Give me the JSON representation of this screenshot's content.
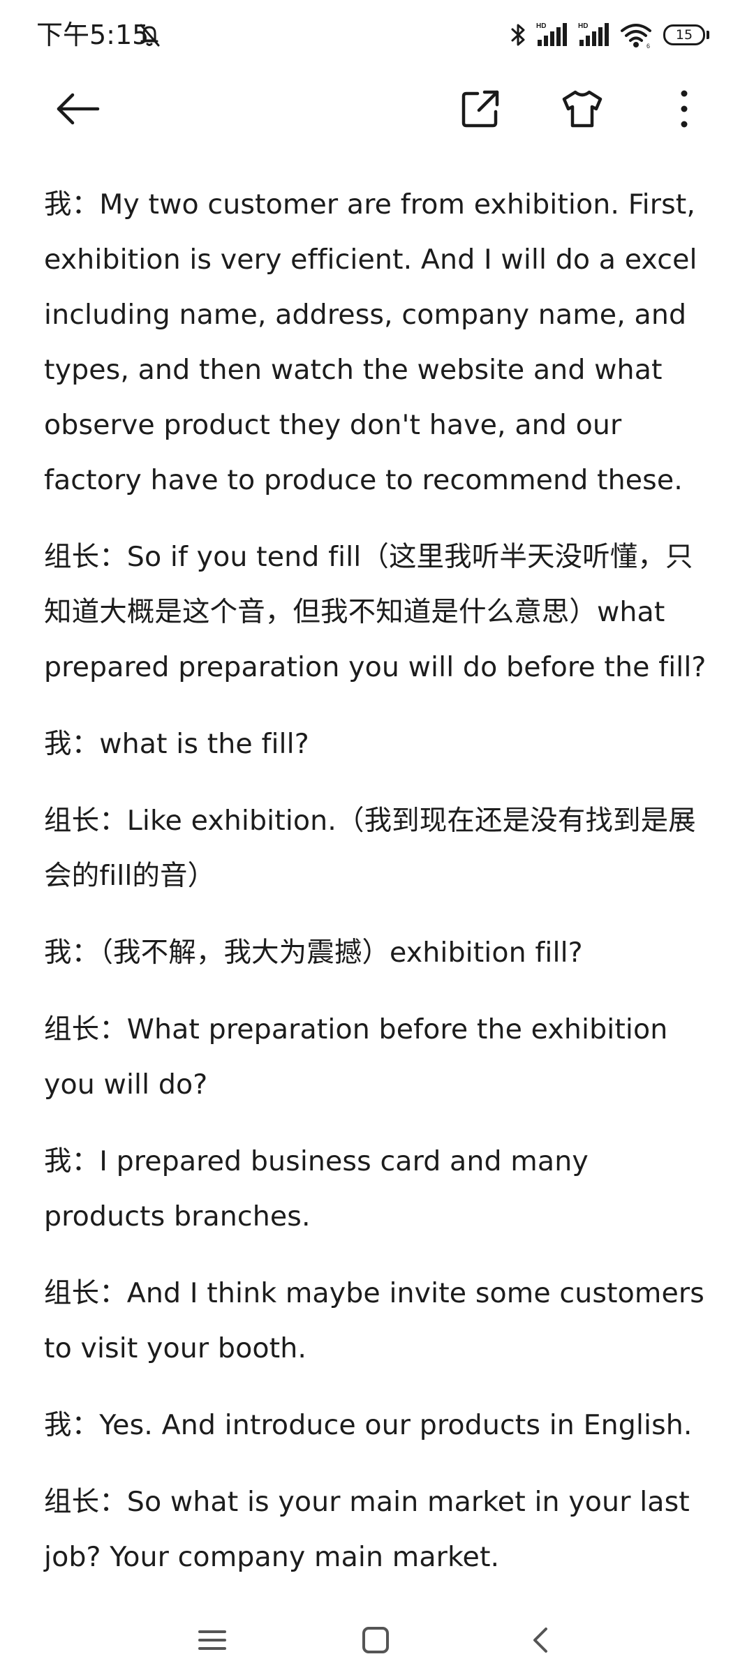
{
  "status_bar": {
    "time": "下午5:15",
    "battery_level": "15",
    "icons": [
      "bell-muted-icon",
      "bluetooth-icon",
      "signal-hd-icon",
      "signal-hd-icon",
      "wifi-icon",
      "battery-icon"
    ]
  },
  "app_bar": {
    "icons": [
      "back-arrow-icon",
      "share-external-icon",
      "theme-shirt-icon",
      "more-vert-icon"
    ]
  },
  "content": {
    "paragraphs": [
      "我：My two customer are from exhibition. First, exhibition is very efficient. And I will do a excel including name, address, company name, and types, and then watch the website and what observe product they don't have, and our factory have to produce to recommend these.",
      "组长：So if you tend fill（这里我听半天没听懂，只知道大概是这个音，但我不知道是什么意思）what prepared preparation you will do before the fill?",
      "我：what is the fill?",
      "组长：Like exhibition.（我到现在还是没有找到是展会的fill的音）",
      "我：（我不解，我大为震撼）exhibition fill?",
      "组长：What preparation before the exhibition you will do?",
      "我：I prepared business card and  many products branches.",
      "组长：And I think maybe invite some customers  to visit your booth.",
      "我：Yes. And introduce our products in English.",
      "组长：So what is your main market in your last job? Your company main market."
    ]
  },
  "nav_bar": {
    "icons": [
      "menu-lines-icon",
      "home-square-icon",
      "back-chevron-icon"
    ]
  },
  "colors": {
    "text": "#1c1c1c",
    "background": "#ffffff",
    "nav_icon": "#555555"
  }
}
